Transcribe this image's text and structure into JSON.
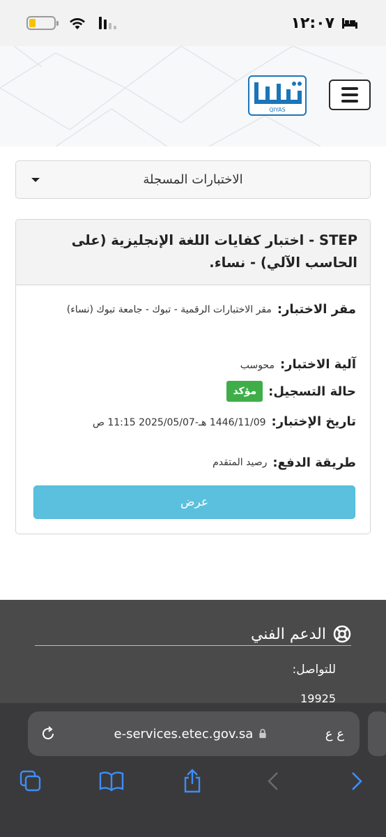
{
  "status_bar": {
    "time": "١٢:٠٧",
    "battery_level": 0.25,
    "battery_color": "#f5c400"
  },
  "header": {
    "logo_text": "QIYAS",
    "menu_icon": "hamburger-icon"
  },
  "dropdown": {
    "selected": "الاختبارات المسجلة"
  },
  "exam_card": {
    "title": "STEP - اختبار كفايات اللغة الإنجليزية (على الحاسب الآلي) - نساء.",
    "location_label": "مقر الاختبار:",
    "location_value": "مقر الاختبارات الرقمية - تبوك - جامعة تبوك (نساء)",
    "method_label": "آلية الاختبار:",
    "method_value": "محوسب",
    "status_label": "حالة التسجيل:",
    "status_value": "مؤكد",
    "status_color": "#3fae49",
    "date_label": "تاريخ الإختبار:",
    "date_value": "1446/11/09 هـ-2025/05/07 11:15 ص",
    "payment_label": "طريقة الدفع:",
    "payment_value": "رصيد المتقدم",
    "view_button": "عرض",
    "button_color": "#5bc0de"
  },
  "footer": {
    "support_title": "الدعم الفني",
    "support_icon": "lifebuoy-icon",
    "contact_label": "للتواصل:",
    "contact_number": "19925"
  },
  "browser": {
    "url": "e-services.etec.gov.sa",
    "text_size_label": "ع ع",
    "toolbar_icons": [
      "tabs-icon",
      "bookmarks-icon",
      "share-icon",
      "back-icon",
      "forward-icon"
    ]
  }
}
